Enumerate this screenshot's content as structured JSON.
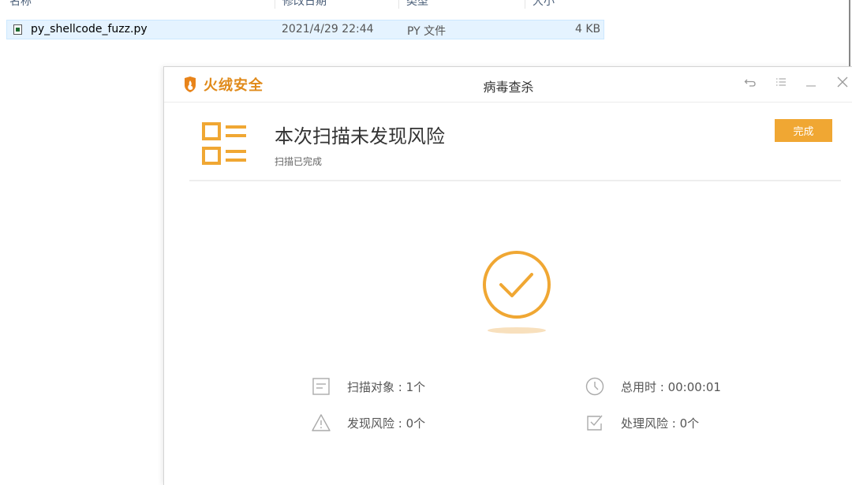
{
  "explorer": {
    "columns": [
      "名称",
      "修改日期",
      "类型",
      "大小"
    ],
    "file": {
      "name": "py_shellcode_fuzz.py",
      "modified": "2021/4/29 22:44",
      "type": "PY 文件",
      "size": "4 KB"
    }
  },
  "dialog": {
    "brand": "火绒安全",
    "title": "病毒查杀",
    "result_title": "本次扫描未发现风险",
    "result_subtitle": "扫描已完成",
    "done_button": "完成",
    "window_controls": [
      "back-icon",
      "menu-icon",
      "minimize-icon",
      "close-icon"
    ],
    "stats": [
      {
        "label": "扫描对象 : 1个",
        "icon": "document-icon"
      },
      {
        "label": "总用时 : 00:00:01",
        "icon": "clock-icon"
      },
      {
        "label": "发现风险 : 0个",
        "icon": "warning-icon"
      },
      {
        "label": "处理风险 : 0个",
        "icon": "checkbox-icon"
      }
    ]
  },
  "colors": {
    "accent": "#f0a733",
    "brand": "#e08a1a",
    "selection": "#e5f3ff"
  }
}
